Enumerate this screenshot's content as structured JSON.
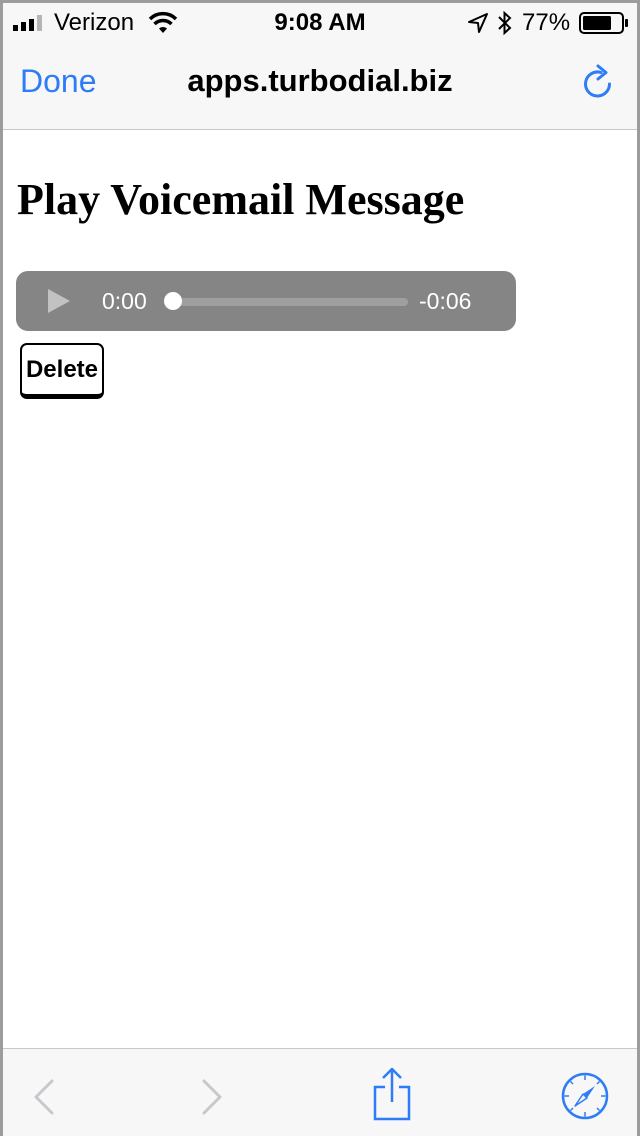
{
  "status_bar": {
    "carrier": "Verizon",
    "time": "9:08 AM",
    "battery_percent": "77%",
    "battery_level": 0.77,
    "icons": [
      "signal-bars-icon",
      "wifi-icon",
      "location-arrow-icon",
      "bluetooth-icon",
      "battery-icon"
    ]
  },
  "nav_bar": {
    "done_label": "Done",
    "title": "apps.turbodial.biz",
    "reload_icon": "reload-icon",
    "accent_color": "#2e7cf6"
  },
  "page": {
    "heading": "Play Voicemail Message",
    "audio_player": {
      "current_time": "0:00",
      "remaining_time": "-0:06",
      "progress": 0,
      "play_icon": "play-icon"
    },
    "delete_label": "Delete"
  },
  "toolbar": {
    "icons": [
      "back-chevron-icon",
      "forward-chevron-icon",
      "share-icon",
      "safari-compass-icon"
    ],
    "disabled_color": "#c7c7cc",
    "enabled_color": "#2e7cf6"
  }
}
